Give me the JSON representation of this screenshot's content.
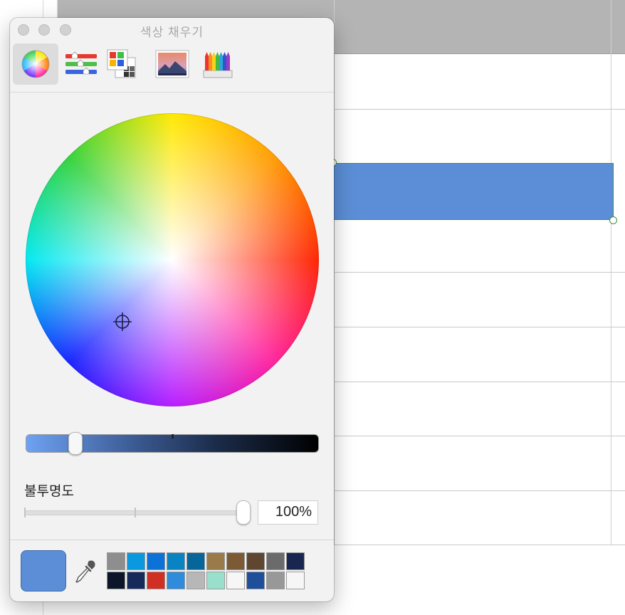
{
  "panel": {
    "title": "색상 채우기",
    "tools": [
      {
        "name": "color-wheel-tool",
        "icon": "color-wheel-icon",
        "active": true
      },
      {
        "name": "color-sliders-tool",
        "icon": "sliders-icon",
        "active": false
      },
      {
        "name": "color-palettes-tool",
        "icon": "palettes-icon",
        "active": false
      },
      {
        "name": "image-palettes-tool",
        "icon": "image-icon",
        "active": false
      },
      {
        "name": "pencils-tool",
        "icon": "pencils-icon",
        "active": false
      }
    ],
    "brightness_level": 0.15,
    "opacity": {
      "label": "불투명도",
      "value": "100%",
      "level": 1.0
    },
    "current_color": "#5b8ed6",
    "swatches": [
      "#8e8e8e",
      "#0a98de",
      "#0c72d8",
      "#0a83c3",
      "#06669a",
      "#9b7a4a",
      "#7c5a36",
      "#5e4630",
      "#6b6b6b",
      "#192750",
      "#0d1629",
      "#162a5c",
      "#d02f24",
      "#2f8bdb",
      "#b7b7b7",
      "#98e0cc",
      "#f6f6f6",
      "#1f4f9b",
      "#989898",
      "#f6f6f6"
    ]
  },
  "background": {
    "shape_fill": "#5b8ed6",
    "selection_color": "#3f8f3f"
  }
}
